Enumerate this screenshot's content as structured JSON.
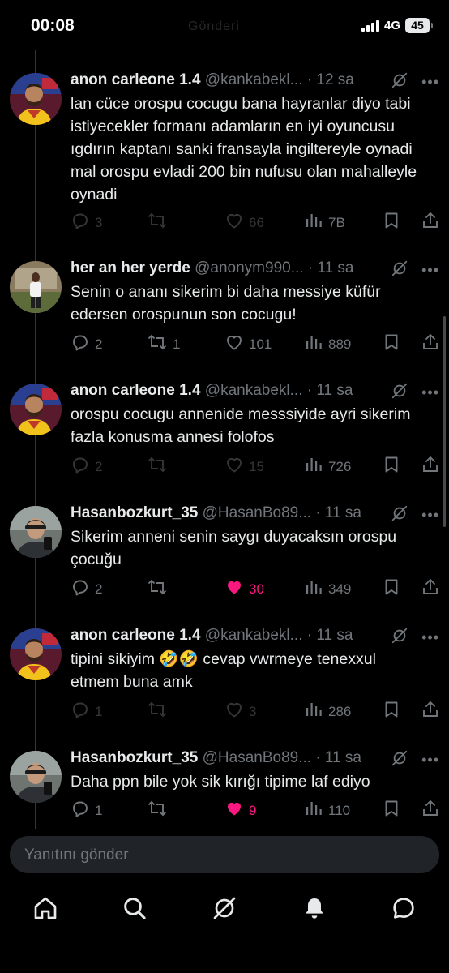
{
  "status_bar": {
    "time": "00:08",
    "ghost_title": "Gönderi",
    "network": "4G",
    "battery": "45"
  },
  "tweets": [
    {
      "name": "anon carleone 1.4",
      "handle": "@kankabekl...",
      "time": "· 12 sa",
      "text": "lan cüce orospu cocugu bana hayranlar diyo tabi istiyecekler formanı adamların en iyi oyuncusu ıgdırın kaptanı sanki fransayla ingiltereyle oynadi mal orospu evladi 200 bin nufusu olan mahalleyle oynadi",
      "replies": "3",
      "reposts": "",
      "likes": "66",
      "views": "7B",
      "liked": false,
      "dim": true
    },
    {
      "name": "her an her yerde",
      "handle": "@anonym990...",
      "time": "· 11 sa",
      "text": "Senin o ananı sikerim bi daha messiye küfür edersen orospunun son cocugu!",
      "replies": "2",
      "reposts": "1",
      "likes": "101",
      "views": "889",
      "liked": false,
      "dim": false
    },
    {
      "name": "anon carleone 1.4",
      "handle": "@kankabekl...",
      "time": "· 11 sa",
      "text": "orospu cocugu annenide messsiyide ayri sikerim fazla konusma annesi folofos",
      "replies": "2",
      "reposts": "",
      "likes": "15",
      "views": "726",
      "liked": false,
      "dim": true
    },
    {
      "name": "Hasanbozkurt_35",
      "handle": "@HasanBo89...",
      "time": "· 11 sa",
      "text": "Sikerim anneni senin saygı duyacaksın orospu çocuğu",
      "replies": "2",
      "reposts": "",
      "likes": "30",
      "views": "349",
      "liked": true,
      "dim": false
    },
    {
      "name": "anon carleone 1.4",
      "handle": "@kankabekl...",
      "time": "· 11 sa",
      "text": "tipini sikiyim 🤣🤣 cevap vwrmeye tenexxul etmem buna amk",
      "replies": "1",
      "reposts": "",
      "likes": "3",
      "views": "286",
      "liked": false,
      "dim": true
    },
    {
      "name": "Hasanbozkurt_35",
      "handle": "@HasanBo89...",
      "time": "· 11 sa",
      "text": "Daha ppn bile yok sik kırığı tipime laf ediyo",
      "replies": "1",
      "reposts": "",
      "likes": "9",
      "views": "110",
      "liked": true,
      "dim": false
    }
  ],
  "avatars": [
    "carleone",
    "heranheryerde",
    "carleone",
    "hasan",
    "carleone",
    "hasan"
  ],
  "reply_box": {
    "placeholder": "Yanıtını gönder"
  },
  "tab_bar": {
    "items": [
      "home-icon",
      "search-icon",
      "grok-icon",
      "notifications-icon",
      "messages-icon"
    ]
  },
  "colors": {
    "background": "#000000",
    "text": "#e7e9ea",
    "secondary": "#71767b",
    "like_active": "#f91880",
    "input_bg": "#202327"
  }
}
